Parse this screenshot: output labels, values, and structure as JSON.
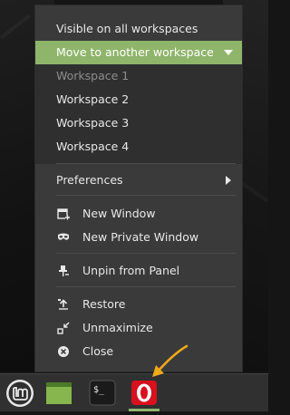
{
  "menu": {
    "visible_on_all_workspaces": "Visible on all workspaces",
    "move_to_workspace": "Move to another workspace",
    "workspaces": [
      "Workspace 1",
      "Workspace 2",
      "Workspace 3",
      "Workspace 4"
    ],
    "preferences": "Preferences",
    "new_window": "New Window",
    "new_private_window": "New Private Window",
    "unpin_from_panel": "Unpin from Panel",
    "restore": "Restore",
    "unmaximize": "Unmaximize",
    "close": "Close"
  },
  "colors": {
    "accent": "#8fb56b",
    "menu_bg": "#3a3a3a",
    "submenu_bg": "#2f2f2f",
    "taskbar_bg": "#303030",
    "opera_red": "#d7111e",
    "annotation_arrow": "#f0a818"
  },
  "icons": {
    "taskbar": [
      "linux-mint-menu-icon",
      "files-folder-icon",
      "terminal-icon",
      "opera-browser-icon"
    ],
    "menu": [
      "new-window-icon",
      "private-window-icon",
      "unpin-icon",
      "restore-icon",
      "unmaximize-icon",
      "close-icon"
    ]
  },
  "taskbar": {
    "terminal_prompt": "$_"
  }
}
